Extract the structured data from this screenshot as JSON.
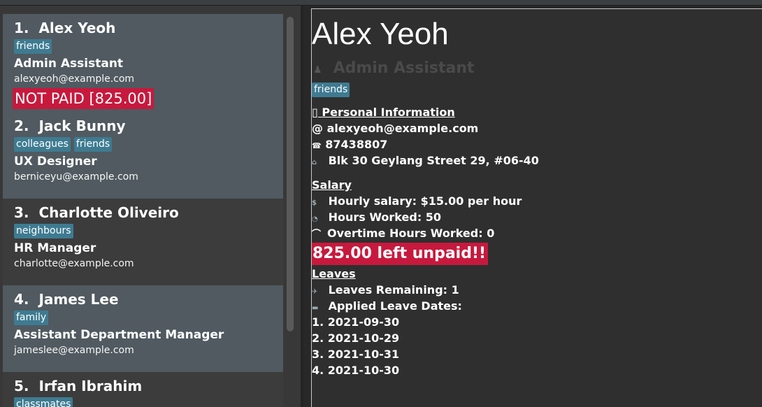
{
  "persons": [
    {
      "index": "1.",
      "name": "Alex Yeoh",
      "tags": [
        "friends"
      ],
      "role": "Admin Assistant",
      "email": "alexyeoh@example.com",
      "unpaid": "NOT PAID [825.00]"
    },
    {
      "index": "2.",
      "name": "Jack Bunny",
      "tags": [
        "colleagues",
        "friends"
      ],
      "role": "UX Designer",
      "email": "berniceyu@example.com"
    },
    {
      "index": "3.",
      "name": "Charlotte Oliveiro",
      "tags": [
        "neighbours"
      ],
      "role": "HR Manager",
      "email": "charlotte@example.com"
    },
    {
      "index": "4.",
      "name": "James Lee",
      "tags": [
        "family"
      ],
      "role": "Assistant Department Manager",
      "email": "jameslee@example.com"
    },
    {
      "index": "5.",
      "name": "Irfan Ibrahim",
      "tags": [
        "classmates"
      ]
    }
  ],
  "detail": {
    "name": "Alex Yeoh",
    "role": "Admin Assistant",
    "tag": "friends",
    "personal_title": "Personal Information",
    "personal_icon": "▯",
    "email": "alexyeoh@example.com",
    "phone": "87438807",
    "address": "Blk 30 Geylang Street 29, #06-40",
    "salary_title": "Salary",
    "hourly": "Hourly salary: $15.00 per hour",
    "hours_worked": "Hours Worked: 50",
    "overtime": "Overtime Hours Worked: 0",
    "unpaid": "825.00 left unpaid!!",
    "leaves_title": "Leaves",
    "leaves_remaining": "Leaves Remaining: 1",
    "applied_title": "Applied Leave Dates:",
    "leave_dates": [
      "1. 2021-09-30",
      "2. 2021-10-29",
      "3. 2021-10-31",
      "4. 2021-10-30"
    ]
  },
  "icons": {
    "email": "@",
    "phone": "☎",
    "address": "⌂",
    "role": "♟",
    "salary": "$",
    "hours": "◔",
    "overtime": "⌒",
    "leaves": "✈",
    "applied": "▬"
  },
  "colors": {
    "tag": "#3e7b91",
    "unpaid": "#c7193d",
    "selected_card": "#505a60"
  }
}
